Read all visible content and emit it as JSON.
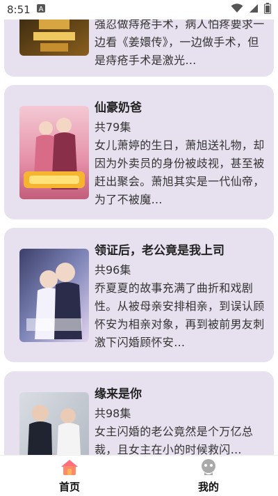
{
  "status_bar": {
    "time": "8:51"
  },
  "cards": [
    {
      "title": "",
      "episodes": "",
      "description": "强忍做痔疮手术，病人怕疼要求一边看《姜嬛传》，一边做手术，但是痔疮手术是激光…"
    },
    {
      "title": "仙豪奶爸",
      "episodes": "共79集",
      "description": "女儿萧婷的生日，萧旭送礼物，却因为外卖员的身份被歧视，甚至被赶出聚会。萧旭其实是一代仙帝，为了不被魔…"
    },
    {
      "title": "领证后，老公竟是我上司",
      "episodes": "共96集",
      "description": "乔夏夏的故事充满了曲折和戏剧性。从被母亲安排相亲，到误认顾怀安为相亲对象，再到被前男友刺激下闪婚顾怀安…"
    },
    {
      "title": "缘来是你",
      "episodes": "共98集",
      "description": "女主闪婚的老公竟然是个万亿总裁，且女主在小的时候救闪…"
    }
  ],
  "tabbar": {
    "home_label": "首页",
    "mine_label": "我的"
  },
  "colors": {
    "card_bg": "#e7e0ef",
    "home_icon_pink": "#ff6f7d",
    "home_icon_orange": "#ffb35a",
    "profile_icon": "#aaaaaa"
  }
}
